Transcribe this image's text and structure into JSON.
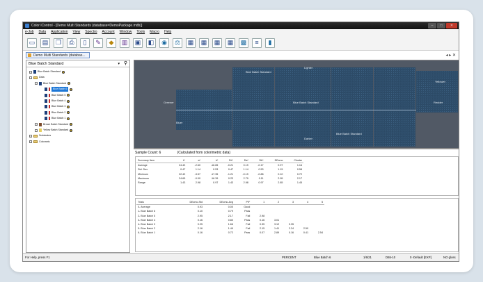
{
  "window": {
    "title": "Color iControl - [Demo Multi Standards (database=DemoPackage.mdb)]",
    "controls": [
      "–",
      "□",
      "✕"
    ]
  },
  "menu": [
    "e-Job",
    "Data",
    "Application",
    "View",
    "Spectro",
    "Account",
    "Window",
    "Tools",
    "Macro",
    "Help"
  ],
  "toolbar_icons": [
    "new-doc-icon",
    "open-doc-icon",
    "copy-icon",
    "print-icon",
    "document-icon",
    "measure-icon",
    "spectro-icon",
    "bars-icon",
    "display-icon",
    "swatch-icon",
    "compare-icon",
    "balance-icon",
    "report-icon",
    "report2-icon",
    "report3-icon",
    "report4-icon",
    "grid-icon",
    "list-icon",
    "chart-icon"
  ],
  "doc_tab": {
    "label": "Demo Multi Standards (databas..."
  },
  "nav_arrows": "◂ ▸ ✕",
  "left_panel": {
    "selector": "Blue Batch Standard",
    "tree": [
      {
        "label": "Blue Batch Standard",
        "color": "#1d3f7a",
        "level": 0,
        "selected": false
      },
      {
        "label": "Data",
        "color": "",
        "level": 0,
        "selected": false,
        "folder": true
      },
      {
        "label": "Blue Batch Standard",
        "color": "#1d3f7a",
        "level": 1,
        "selected": false
      },
      {
        "label": "Blue Batch 6",
        "color": "#1d3f7a",
        "level": 2,
        "selected": true
      },
      {
        "label": "Blue Batch 5",
        "color": "#1d3f7a",
        "level": 2,
        "selected": false
      },
      {
        "label": "Blue Batch 4",
        "color": "#1d3f7a",
        "level": 2,
        "selected": false
      },
      {
        "label": "Blue Batch 3",
        "color": "#1d3f7a",
        "level": 2,
        "selected": false
      },
      {
        "label": "Blue Batch 2",
        "color": "#1d3f7a",
        "level": 2,
        "selected": false
      },
      {
        "label": "Blue Batch 1",
        "color": "#1d3f7a",
        "level": 2,
        "selected": false
      },
      {
        "label": "Brown Batch Standard",
        "color": "#7a4a2a",
        "level": 1,
        "selected": false
      },
      {
        "label": "Yellow Batch Standard",
        "color": "#e8d060",
        "level": 1,
        "selected": false
      },
      {
        "label": "Substrates",
        "color": "",
        "level": 0,
        "selected": false,
        "folder": true
      },
      {
        "label": "Colorants",
        "color": "",
        "level": 0,
        "selected": false,
        "folder": true
      }
    ]
  },
  "visual": {
    "labels": {
      "lighter": "Lighter",
      "darker": "Darker",
      "greener": "Greener",
      "redder": "Redder",
      "bluer": "Bluer",
      "yellower": "Yellower",
      "center": "Blue Batch Standard",
      "top": "Blue Batch Standard",
      "bottom": "Blue Batch Standard"
    }
  },
  "summary": {
    "sample_count": "Sample Count: 6",
    "note": "(Calculated from colorimetric data)",
    "headers": [
      "Summary Item",
      "L*",
      "a*",
      "b*",
      "DL*",
      "Da*",
      "Db*",
      "DEcmc",
      "Cluster"
    ],
    "rows": [
      [
        "Average",
        "24.42",
        "-2.60",
        "-16.65",
        "-0.21",
        "0.19",
        "-0.17",
        "0.97",
        "1.16"
      ],
      [
        "Std. Dev.",
        "0.47",
        "1.14",
        "0.53",
        "0.47",
        "1.14",
        "0.53",
        "1.15",
        "0.58"
      ],
      [
        "Minimum",
        "22.42",
        "-3.57",
        "-17.35",
        "-1.21",
        "-0.19",
        "-0.88",
        "0.10",
        "0.72"
      ],
      [
        "Maximum",
        "24.65",
        "-0.00",
        "-16.39",
        "0.23",
        "2.79",
        "0.11",
        "2.95",
        "2.17"
      ],
      [
        "Range",
        "1.43",
        "2.98",
        "0.97",
        "1.43",
        "2.98",
        "0.97",
        "2.85",
        "1.45"
      ]
    ]
  },
  "trials": {
    "headers": [
      "Trials",
      "DEcmc-Std",
      "DEcmc-Avg",
      "P/F",
      "1",
      "2",
      "3",
      "4",
      "5"
    ],
    "rows": [
      [
        "0- Average",
        "0.93",
        "0.00",
        "Good",
        "",
        "",
        "",
        "",
        ""
      ],
      [
        "1- Blue Batch 6",
        "0.10",
        "0.79",
        "Pass",
        "",
        "",
        "",
        "",
        ""
      ],
      [
        "2- Blue Batch 5",
        "2.95",
        "2.17",
        "Fail",
        "2.98",
        "",
        "",
        "",
        ""
      ],
      [
        "3- Blue Batch 4",
        "0.16",
        "0.80",
        "Pass",
        "0.16",
        "3.01",
        "",
        "",
        ""
      ],
      [
        "4- Blue Batch 3",
        "0.25",
        "1.66",
        "Fail",
        "0.35",
        "3.12",
        "0.35",
        "",
        ""
      ],
      [
        "5- Blue Batch 2",
        "2.16",
        "1.49",
        "Fail",
        "2.15",
        "1.41",
        "2.24",
        "2.50",
        ""
      ],
      [
        "6- Blue Batch 1",
        "0.16",
        "0.72",
        "Pass",
        "0.07",
        "2.89",
        "0.16",
        "0.41",
        "2.54"
      ]
    ]
  },
  "status": {
    "help": "For Help, press F1",
    "mode": "PERCENT",
    "sample": "Blue Batch 6",
    "page": "1/6/21",
    "illuminant": "D65-10",
    "profile": "0 -Default [EXP]",
    "gloss": "NO gloss"
  }
}
